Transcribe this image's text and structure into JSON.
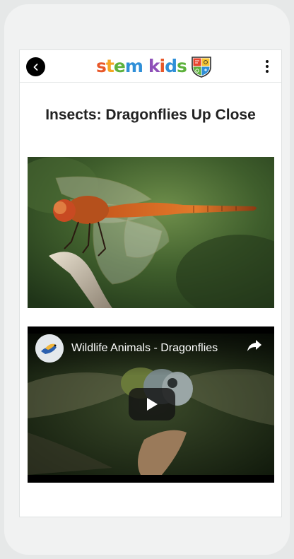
{
  "app": {
    "logo": {
      "stem_letters": [
        {
          "char": "s",
          "color": "#e8582a"
        },
        {
          "char": "t",
          "color": "#f5a623"
        },
        {
          "char": "e",
          "color": "#5db13c"
        },
        {
          "char": "m",
          "color": "#2f8fd8"
        }
      ],
      "kids_letters": [
        {
          "char": "k",
          "color": "#8e4fb8"
        },
        {
          "char": "i",
          "color": "#e8582a"
        },
        {
          "char": "d",
          "color": "#2f8fd8"
        },
        {
          "char": "s",
          "color": "#5db13c"
        }
      ],
      "badge_icon": "shield-crest-icon"
    },
    "header": {
      "back_icon": "chevron-left-icon",
      "menu_icon": "more-vertical-icon"
    }
  },
  "page": {
    "title": "Insects: Dragonflies Up Close"
  },
  "hero_image": {
    "subject": "dragonfly"
  },
  "video": {
    "title": "Wildlife Animals - Dragonflies",
    "share_icon": "share-arrow-icon",
    "play_icon": "play-icon"
  },
  "colors": {
    "page_background": "#e6e8e8",
    "phone_frame": "#f1f2f2",
    "screen_background": "#ffffff",
    "title_text": "#222222",
    "video_background": "#000000"
  }
}
